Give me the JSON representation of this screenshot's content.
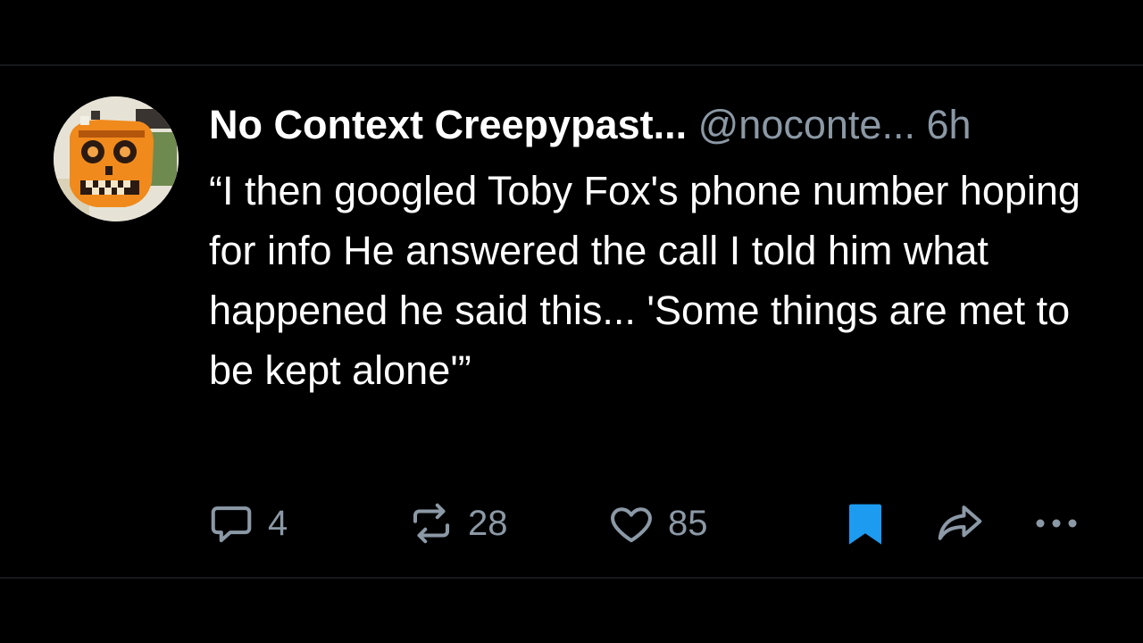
{
  "post": {
    "display_name": "No Context Creepypast...",
    "handle": "@noconte...",
    "time": "6h",
    "text": "“I then googled Toby Fox's phone number hoping for info He answered the call I told him what happened he said this... 'Some things are met to be kept alone'”"
  },
  "actions": {
    "reply": {
      "icon": "reply-icon",
      "count": "4"
    },
    "repost": {
      "icon": "repost-icon",
      "count": "28"
    },
    "like": {
      "icon": "heart-icon",
      "count": "85"
    },
    "bookmark": {
      "icon": "bookmark-icon"
    },
    "share": {
      "icon": "share-icon"
    },
    "more": {
      "icon": "more-icon"
    }
  },
  "colors": {
    "background": "#000000",
    "text": "#ffffff",
    "muted": "#8b98a5",
    "accent": "#1d9bf0"
  }
}
